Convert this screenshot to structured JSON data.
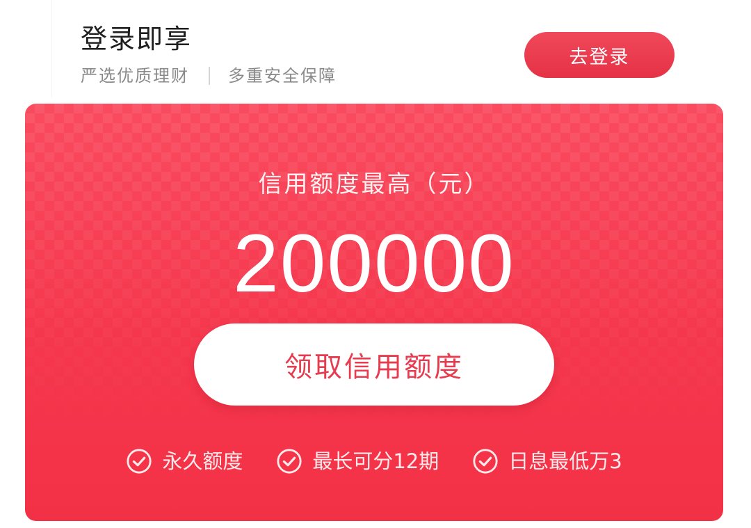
{
  "header": {
    "title": "登录即享",
    "subtitle_left": "严选优质理财",
    "subtitle_right": "多重安全保障",
    "login_button": "去登录"
  },
  "card": {
    "limit_label": "信用额度最高（元）",
    "limit_amount": "200000",
    "claim_button": "领取信用额度",
    "features": [
      {
        "label": "永久额度",
        "icon": "check-circle-icon"
      },
      {
        "label": "最长可分12期",
        "icon": "check-circle-icon"
      },
      {
        "label": "日息最低万3",
        "icon": "check-circle-icon"
      }
    ]
  },
  "colors": {
    "brand_red": "#f33c50",
    "button_red": "#e9384b",
    "white": "#ffffff"
  }
}
